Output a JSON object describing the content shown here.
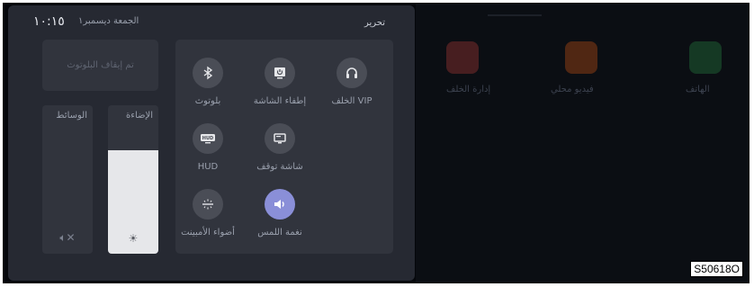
{
  "status": {
    "time": "١٠:١٥",
    "date": "الجمعة ديسمبر١",
    "edit_label": "تحرير"
  },
  "bluetooth_status": "تم إيقاف البلوتوث",
  "sliders": {
    "media": {
      "label": "الوسائط",
      "icon": "speaker-mute-icon",
      "level": 0
    },
    "brightness": {
      "label": "الإضاءة",
      "icon": "sun-icon",
      "level": 0.7
    }
  },
  "tiles": [
    {
      "label": "الخلف VIP",
      "icon": "headphones-icon",
      "active": false
    },
    {
      "label": "إطفاء الشاشة",
      "icon": "screen-off-icon",
      "active": false
    },
    {
      "label": "بلوتوث",
      "icon": "bluetooth-icon",
      "active": false
    },
    {
      "label": "شاشة توقف",
      "icon": "monitor-icon",
      "active": false
    },
    {
      "label": "HUD",
      "icon": "hud-icon",
      "active": false
    },
    {
      "label": "نغمة اللمس",
      "icon": "speaker-icon",
      "active": true
    },
    {
      "label": "أضواء الأمبينت",
      "icon": "ambient-light-icon",
      "active": false
    }
  ],
  "background_apps": [
    {
      "label": "الهاتف",
      "icon": "phone-icon"
    },
    {
      "label": "فيديو محلي",
      "icon": "video-icon"
    },
    {
      "label": "إدارة الخلف",
      "icon": "rear-control-icon"
    }
  ],
  "reference_code": "S50618O",
  "colors": {
    "panel": "#262932",
    "tile": "#31343d",
    "icon_circle": "#4a4d56",
    "active": "#8a8fd8",
    "slider_fill": "#e6e7ea"
  }
}
